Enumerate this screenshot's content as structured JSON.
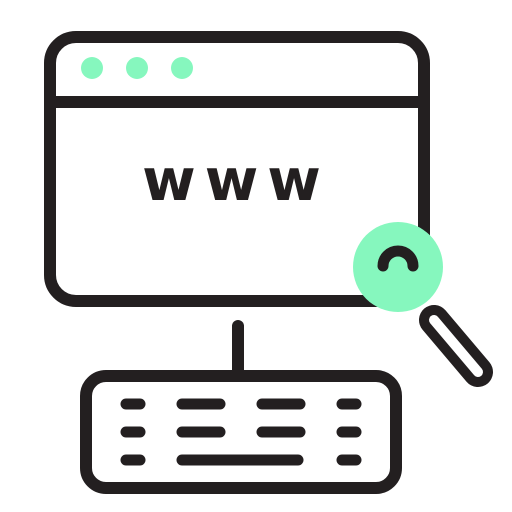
{
  "browser": {
    "address_text": "www",
    "dot_color": "#86f7be"
  },
  "colors": {
    "outline": "#231f20",
    "accent": "#86f7be",
    "background": "#ffffff"
  },
  "icons": {
    "monitor": "browser-window-icon",
    "search": "magnifier-icon",
    "keyboard": "keyboard-icon"
  }
}
